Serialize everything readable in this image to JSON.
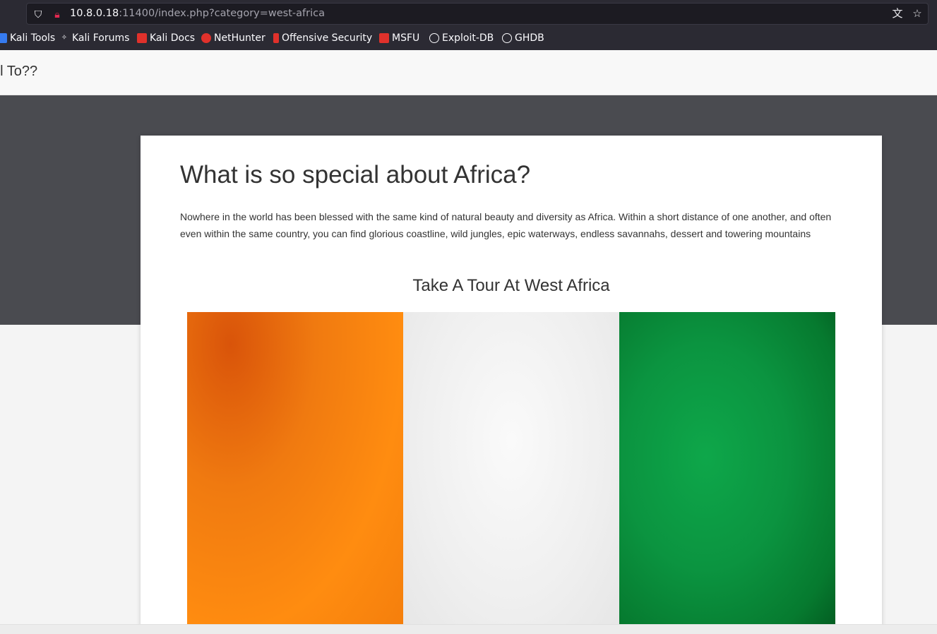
{
  "browser": {
    "url_host": "10.8.0.18",
    "url_rest": ":11400/index.php?category=west-africa",
    "bookmarks": [
      {
        "label": "Kali Tools",
        "icon": "kali-icon",
        "color": "#367bf0"
      },
      {
        "label": "Kali Forums",
        "icon": "kali-dragon-icon",
        "color": "#ffffff"
      },
      {
        "label": "Kali Docs",
        "icon": "docs-icon",
        "color": "#e0312b"
      },
      {
        "label": "NetHunter",
        "icon": "nethunter-icon",
        "color": "#e0312b"
      },
      {
        "label": "Offensive Security",
        "icon": "offsec-icon",
        "color": "#e0312b"
      },
      {
        "label": "MSFU",
        "icon": "msfu-icon",
        "color": "#e0312b"
      },
      {
        "label": "Exploit-DB",
        "icon": "globe-icon",
        "color": "#fbfbfe"
      },
      {
        "label": "GHDB",
        "icon": "globe-icon",
        "color": "#fbfbfe"
      }
    ]
  },
  "site": {
    "brand": "el To??"
  },
  "content": {
    "heading": "What is so special about Africa?",
    "paragraph": "Nowhere in the world has been blessed with the same kind of natural beauty and diversity as Africa. Within a short distance of one another, and often even within the same country, you can find glorious coastline, wild jungles, epic waterways, endless savannahs, dessert and towering mountains",
    "subheading": "Take A Tour At West Africa",
    "image": {
      "icon": "ivory-coast-flag-image",
      "colors": [
        "#f77f00",
        "#ffffff",
        "#009e49"
      ]
    }
  }
}
